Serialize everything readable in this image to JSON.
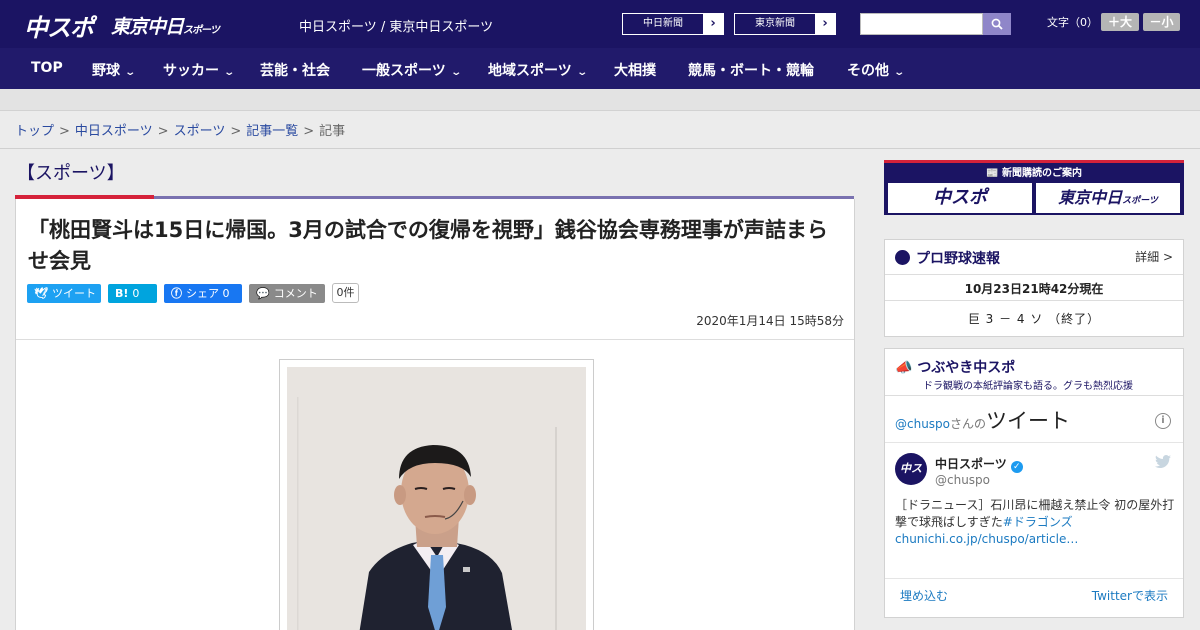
{
  "header": {
    "logo_main": "中スポ",
    "logo_tokyo": "東京中日",
    "logo_tokyo_small": "スポーツ",
    "site_name": "中日スポーツ / 東京中日スポーツ",
    "paper_links": [
      {
        "label": "中日新聞"
      },
      {
        "label": "東京新聞"
      }
    ],
    "search": {
      "placeholder": ""
    },
    "font_size_label": "文字（0）",
    "font_larger": "＋大",
    "font_smaller": "－小"
  },
  "nav": {
    "items": [
      {
        "label": "TOP",
        "has_menu": false
      },
      {
        "label": "野球",
        "has_menu": true
      },
      {
        "label": "サッカー",
        "has_menu": true
      },
      {
        "label": "芸能・社会",
        "has_menu": false
      },
      {
        "label": "一般スポーツ",
        "has_menu": true
      },
      {
        "label": "地域スポーツ",
        "has_menu": true
      },
      {
        "label": "大相撲",
        "has_menu": false
      },
      {
        "label": "競馬・ボート・競輪",
        "has_menu": false
      },
      {
        "label": "その他",
        "has_menu": true
      }
    ]
  },
  "breadcrumb": {
    "items": [
      "トップ",
      "中日スポーツ",
      "スポーツ",
      "記事一覧"
    ],
    "current": "記事",
    "separator": ">"
  },
  "section_title": "【スポーツ】",
  "article": {
    "headline": "「桃田賢斗は15日に帰国。3月の試合での復帰を視野」銭谷協会専務理事が声詰まらせ会見",
    "share": {
      "tweet": "ツイート",
      "hatena_icon": "B!",
      "hatena_count": "0",
      "facebook_label": "シェア",
      "facebook_count": "0",
      "comment": "コメント",
      "comment_count": "0件"
    },
    "date": "2020年1月14日 15時58分"
  },
  "sidebar": {
    "subscribe": {
      "title": "新聞購読のご案内",
      "logo_left": "中スポ",
      "logo_right": "東京中日",
      "logo_right_small": "スポーツ"
    },
    "baseball": {
      "title": "プロ野球速報",
      "detail": "詳細 >",
      "time": "10月23日21時42分現在",
      "score": "巨 3 － 4 ソ （終了）"
    },
    "tsubuyaki": {
      "title": "つぶやき中スポ",
      "subtitle": "ドラ観戦の本紙評論家も語る。グラも熱烈応援",
      "handle": "@chuspo",
      "handle_suffix": "さんの",
      "tweet_word": "ツイート",
      "account_name": "中日スポーツ",
      "account_handle": "@chuspo",
      "avatar_text": "中スポ",
      "tweet_text": "［ドラニュース］石川昂に柵越え禁止令 初の屋外打撃で球飛ばしすぎた",
      "tweet_tag": "#ドラゴンズ",
      "tweet_url": "chunichi.co.jp/chuspo/article…",
      "embed": "埋め込む",
      "view_on_twitter": "Twitterで表示"
    }
  },
  "colors": {
    "header_bg": "#1b1463",
    "nav_bg": "#211a6b",
    "accent_red": "#d5223a",
    "link_blue": "#2a4aa0",
    "twitter_blue": "#1d9bf0",
    "facebook_blue": "#1877f2",
    "hatena_blue": "#00a4de",
    "comment_gray": "#8a8a8a"
  }
}
